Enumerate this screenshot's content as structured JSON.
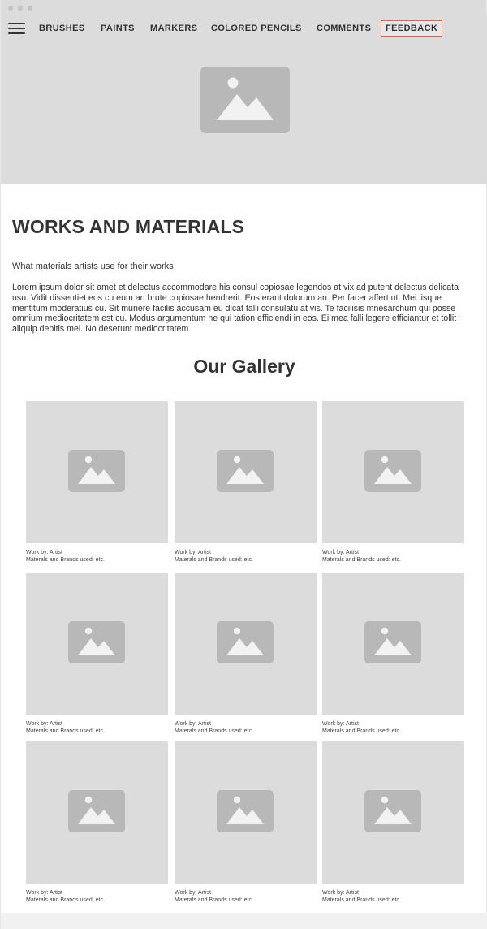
{
  "nav": {
    "items": [
      {
        "label": "BRUSHES"
      },
      {
        "label": "PAINTS"
      },
      {
        "label": "MARKERS"
      },
      {
        "label": "COLORED PENCILS"
      },
      {
        "label": "COMMENTS"
      },
      {
        "label": "FEEDBACK"
      }
    ],
    "menu_icon": "hamburger-menu-icon",
    "feedback_border_color": "#e0624a"
  },
  "hero": {
    "icon": "image-placeholder-icon",
    "background": "#dcdcdc"
  },
  "intro": {
    "title": "WORKS AND MATERIALS",
    "subtitle": "What materials artists use for their works",
    "body": "Lorem ipsum dolor sit amet et delectus accommodare his consul copiosae legendos at vix ad putent delectus delicata usu. Vidit dissentiet eos cu eum an brute copiosae hendrerit. Eos erant dolorum an. Per facer affert ut. Mei iisque mentitum moderatius cu. Sit munere facilis accusam eu dicat falli consulatu at vis. Te facilisis mnesarchum qui posse omnium mediocritatem est cu. Modus argumentum ne qui tation efficiendi in eos. Ei mea falli legere efficiantur et tollit aliquip debitis mei. No deserunt mediocritatem"
  },
  "gallery": {
    "title": "Our Gallery",
    "items": [
      {
        "artist": "Work by: Artist",
        "materials": "Materals and Brands used: etc."
      },
      {
        "artist": "Work by: Artist",
        "materials": "Materals and Brands used: etc."
      },
      {
        "artist": "Work by: Artist",
        "materials": "Materals and Brands used: etc."
      },
      {
        "artist": "Work by: Artist",
        "materials": "Materals and Brands used: etc."
      },
      {
        "artist": "Work by: Artist",
        "materials": "Materals and Brands used: etc."
      },
      {
        "artist": "Work by: Artist",
        "materials": "Materals and Brands used: etc."
      },
      {
        "artist": "Work by: Artist",
        "materials": "Materals and Brands used: etc."
      },
      {
        "artist": "Work by: Artist",
        "materials": "Materals and Brands used: etc."
      },
      {
        "artist": "Work by: Artist",
        "materials": "Materals and Brands used: etc."
      }
    ]
  }
}
